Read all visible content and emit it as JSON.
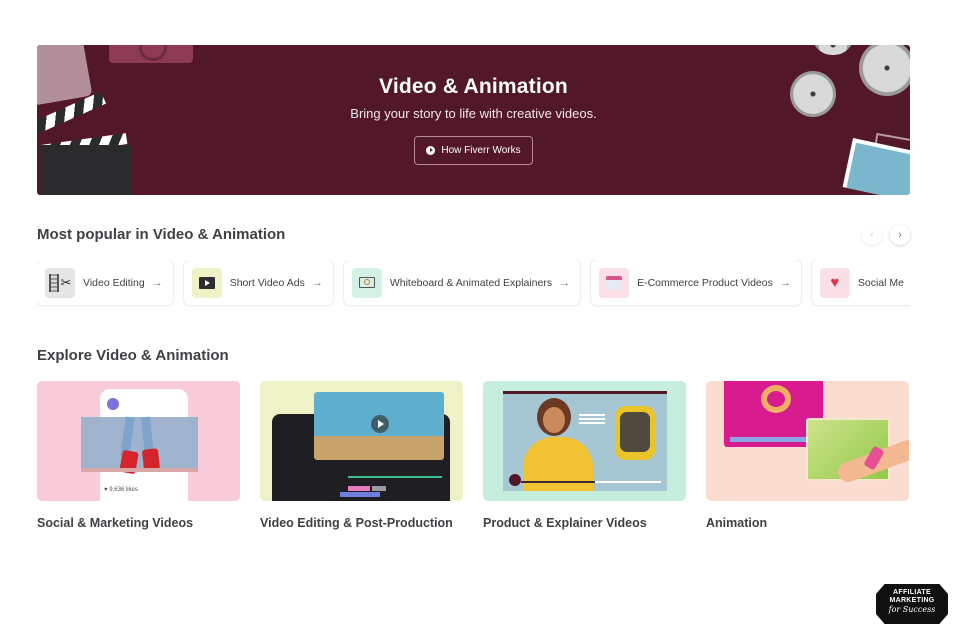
{
  "hero": {
    "title": "Video & Animation",
    "subtitle": "Bring your story to life with creative videos.",
    "button_label": "How Fiverr Works",
    "button_icon": "play-circle-icon",
    "background_color": "#521828"
  },
  "popular": {
    "title": "Most popular in Video & Animation",
    "prev_icon": "‹",
    "next_icon": "›",
    "arrow_glyph": "→",
    "items": [
      {
        "label": "Video Editing",
        "icon": "film-scissors-icon",
        "icon_bg": "#e4e5e7"
      },
      {
        "label": "Short Video Ads",
        "icon": "video-screen-icon",
        "icon_bg": "#eef2c6"
      },
      {
        "label": "Whiteboard & Animated Explainers",
        "icon": "whiteboard-icon",
        "icon_bg": "#d4f2e4"
      },
      {
        "label": "E-Commerce Product Videos",
        "icon": "shop-cart-icon",
        "icon_bg": "#fbdfe7"
      },
      {
        "label": "Social Me",
        "icon": "heart-play-icon",
        "icon_bg": "#fbdfe7"
      }
    ]
  },
  "explore": {
    "title": "Explore Video & Animation",
    "cards": [
      {
        "title": "Social & Marketing Videos",
        "likes_text": "♥ 9,636 likes"
      },
      {
        "title": "Video Editing & Post-Production"
      },
      {
        "title": "Product & Explainer Videos"
      },
      {
        "title": "Animation"
      }
    ]
  },
  "watermark": {
    "line1": "AFFILIATE",
    "line2": "MARKETING",
    "line3": "for Success"
  }
}
